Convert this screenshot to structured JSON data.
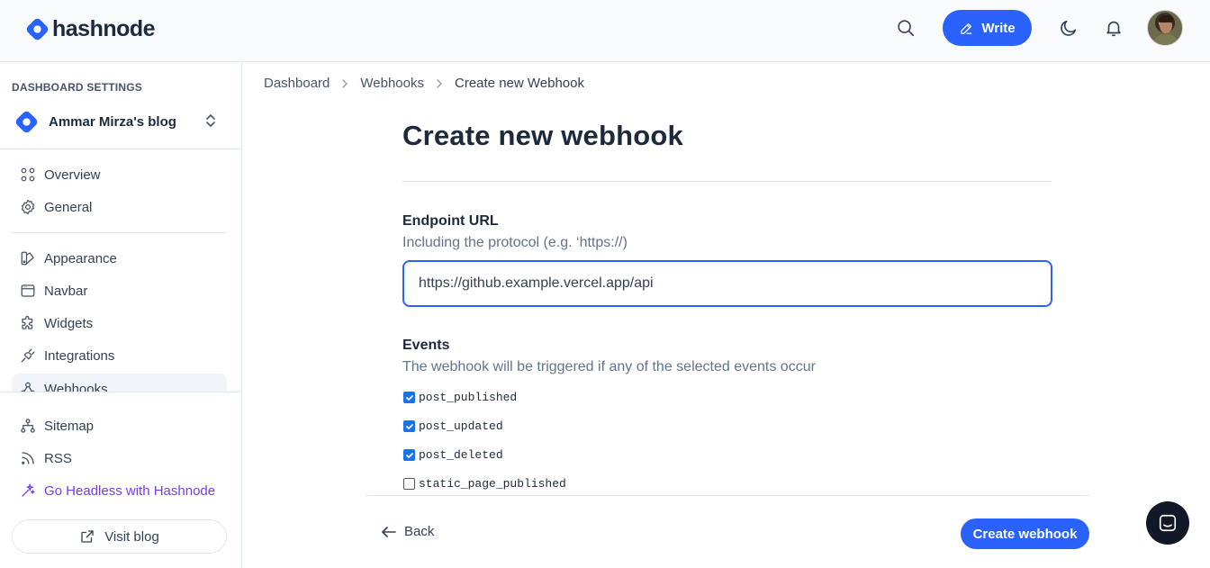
{
  "brand": {
    "name": "hashnode",
    "accent": "#2962ff"
  },
  "header": {
    "write_label": "Write"
  },
  "sidebar": {
    "heading": "DASHBOARD SETTINGS",
    "blog_name": "Ammar Mirza's blog",
    "items": [
      {
        "label": "Overview",
        "icon": "overview-icon"
      },
      {
        "label": "General",
        "icon": "gear-icon"
      },
      {
        "label": "Appearance",
        "icon": "appearance-icon"
      },
      {
        "label": "Navbar",
        "icon": "navbar-icon"
      },
      {
        "label": "Widgets",
        "icon": "widgets-icon"
      },
      {
        "label": "Integrations",
        "icon": "plug-icon"
      },
      {
        "label": "Webhooks",
        "icon": "webhook-icon",
        "active": true
      },
      {
        "label": "Sitemap",
        "icon": "sitemap-icon"
      },
      {
        "label": "RSS",
        "icon": "rss-icon"
      },
      {
        "label": "Go Headless with Hashnode",
        "icon": "sparkle-icon"
      }
    ],
    "visit_label": "Visit blog"
  },
  "breadcrumb": [
    "Dashboard",
    "Webhooks",
    "Create new Webhook"
  ],
  "main": {
    "title": "Create new webhook",
    "endpoint": {
      "label": "Endpoint URL",
      "help": "Including the protocol (e.g. ‘https://)",
      "value": "https://github.example.vercel.app/api"
    },
    "events": {
      "label": "Events",
      "help": "The webhook will be triggered if any of the selected events occur",
      "items": [
        {
          "name": "post_published",
          "checked": true
        },
        {
          "name": "post_updated",
          "checked": true
        },
        {
          "name": "post_deleted",
          "checked": true
        },
        {
          "name": "static_page_published",
          "checked": false
        }
      ]
    }
  },
  "footer": {
    "back_label": "Back",
    "create_label": "Create webhook"
  }
}
